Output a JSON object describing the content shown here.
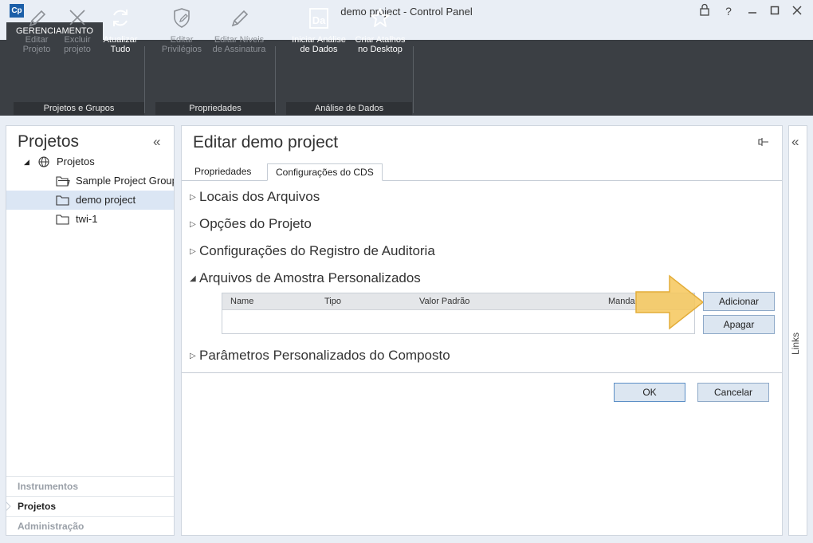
{
  "window": {
    "title": "demo project - Control Panel",
    "logo": "Cp",
    "buttons": [
      "lock-icon",
      "help-icon",
      "minimize-icon",
      "maximize-icon",
      "close-icon"
    ]
  },
  "ribbon": {
    "active_tab": "GERENCIAMENTO",
    "groups": [
      {
        "label": "Projetos e Grupos",
        "buttons": [
          {
            "line1": "Editar",
            "line2": "Projeto",
            "icon": "pencil-icon",
            "enabled": false
          },
          {
            "line1": "Excluir",
            "line2": "projeto",
            "icon": "x-icon",
            "enabled": false
          },
          {
            "line1": "Atualizar",
            "line2": "Tudo",
            "icon": "refresh-icon",
            "enabled": true
          }
        ]
      },
      {
        "label": "Propriedades",
        "buttons": [
          {
            "line1": "Editar",
            "line2": "Privilégios",
            "icon": "shield-pencil-icon",
            "enabled": false
          },
          {
            "line1": "Editar Níveis",
            "line2": "de Assinatura",
            "icon": "pencil-icon",
            "enabled": false
          }
        ]
      },
      {
        "label": "Análise de Dados",
        "buttons": [
          {
            "line1": "Iniciar Análise",
            "line2": "de Dados",
            "icon": "data-analysis-icon",
            "enabled": true
          },
          {
            "line1": "Criar Atalhos",
            "line2": "no Desktop",
            "icon": "star-icon",
            "enabled": true
          }
        ]
      }
    ]
  },
  "left_panel": {
    "title": "Projetos",
    "tree": [
      {
        "label": "Projetos",
        "icon": "globe-icon",
        "expanded": true
      },
      {
        "label": "Sample Project Group",
        "icon": "folder-open-icon"
      },
      {
        "label": "demo project",
        "icon": "folder-icon",
        "selected": true
      },
      {
        "label": "twi-1",
        "icon": "folder-icon"
      }
    ],
    "nav": [
      "Instrumentos",
      "Projetos",
      "Administração"
    ]
  },
  "main": {
    "title": "Editar demo project",
    "tabs": [
      "Propriedades",
      "Configurações do CDS"
    ],
    "active_tab": "Configurações do CDS",
    "sections": [
      {
        "label": "Locais dos Arquivos",
        "expanded": false
      },
      {
        "label": "Opções do Projeto",
        "expanded": false
      },
      {
        "label": "Configurações do Registro de Auditoria",
        "expanded": false
      },
      {
        "label": "Arquivos de Amostra Personalizados",
        "expanded": true
      },
      {
        "label": "Parâmetros Personalizados do Composto",
        "expanded": false
      }
    ],
    "grid_columns": [
      "Name",
      "Tipo",
      "Valor Padrão",
      "Manda"
    ],
    "add_button": "Adicionar",
    "delete_button": "Apagar",
    "ok_button": "OK",
    "cancel_button": "Cancelar",
    "highlight_color": "#f6c75b"
  },
  "right_panel": {
    "label": "Links"
  }
}
